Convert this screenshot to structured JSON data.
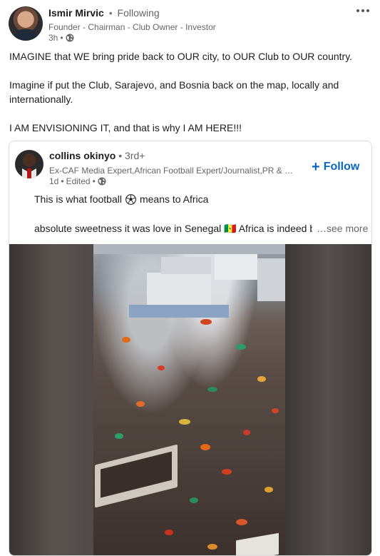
{
  "post": {
    "author_name": "Ismir Mirvic",
    "follow_status": "Following",
    "headline": "Founder - Chairman - Club Owner - Investor",
    "time": "3h",
    "visibility_icon": "globe-icon",
    "more_icon": "more-options-icon",
    "paragraphs": [
      "IMAGINE that WE bring pride back to OUR city, to OUR Club to OUR country.",
      "Imagine if put the Club, Sarajevo, and Bosnia back on the map, locally and internationally.",
      "I AM ENVISIONING IT, and that is why I AM HERE!!!"
    ]
  },
  "shared": {
    "author_name": "collins okinyo",
    "degree": "3rd+",
    "headline": "Ex-CAF Media Expert,African Football Expert/Journalist,PR & Co...",
    "time": "1d",
    "edited": "Edited",
    "follow_label": "Follow",
    "line1_before": "This is what football",
    "line1_icon": "soccer-ball-icon",
    "line1_after": "means to Africa",
    "line2": "absolute sweetness it was love in Senegal 🇸🇳 Africa is indeed blessed",
    "see_more": "…see more",
    "accent_color": "#0a66c2"
  }
}
